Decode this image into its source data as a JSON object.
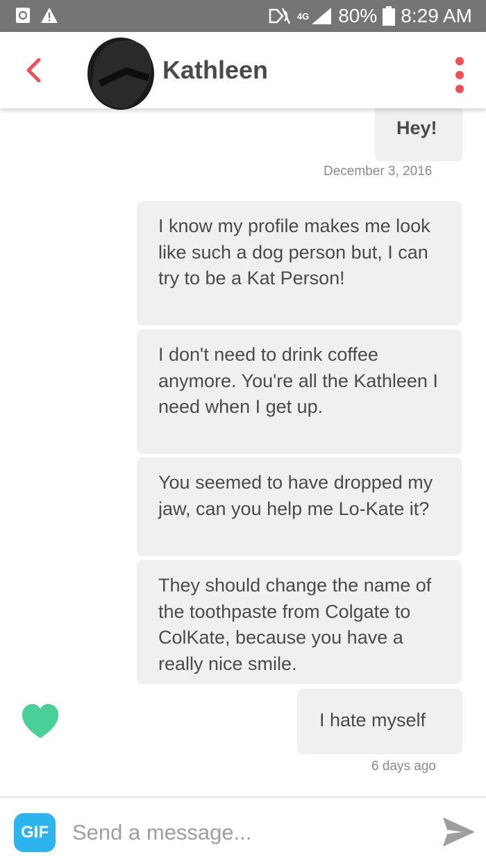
{
  "status_bar": {
    "network": "4G",
    "battery": "80%",
    "time": "8:29 AM",
    "icons": [
      "recycle-notification-icon",
      "warning-icon",
      "nfc-icon",
      "signal-icon",
      "battery-icon"
    ]
  },
  "header": {
    "contact_name": "Kathleen",
    "icons": [
      "back-chevron-icon",
      "avatar-redacted",
      "more-vertical-icon"
    ]
  },
  "messages": [
    {
      "text": "Hey!",
      "from": "me"
    },
    {
      "timestamp": "December 3, 2016"
    },
    {
      "text": "I know my profile makes me look like such a dog person but, I can try to be a Kat Person!",
      "from": "me"
    },
    {
      "text": "I don't need to drink coffee anymore. You're all the Kathleen I need when I get up.",
      "from": "me"
    },
    {
      "text": "You seemed to have dropped my jaw, can you help me Lo-Kate it?",
      "from": "me"
    },
    {
      "text": "They should change the name of the toothpaste from Colgate to ColKate, because you have a really nice smile.",
      "from": "me"
    },
    {
      "text": "I hate myself",
      "from": "me"
    },
    {
      "timestamp": "6 days ago"
    }
  ],
  "reaction": {
    "icon": "heart-icon",
    "color": "#48d098"
  },
  "composer": {
    "gif_label": "GIF",
    "placeholder": "Send a message...",
    "send_icon": "send-icon"
  },
  "colors": {
    "accent": "#ef4f57",
    "bubble": "#f0f0f0",
    "gif": "#2bb5ec",
    "heart": "#48d098",
    "status_bar": "#757575"
  }
}
